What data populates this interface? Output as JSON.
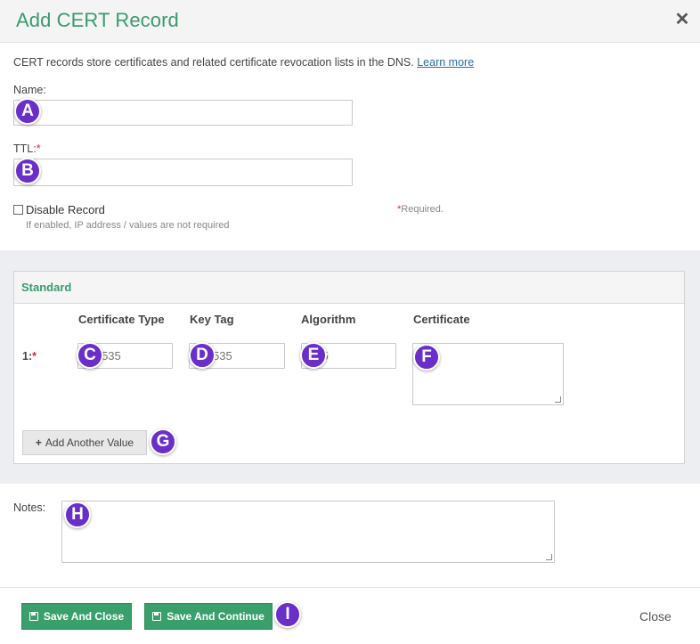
{
  "dialog": {
    "title": "Add CERT Record",
    "close_icon": "close-icon"
  },
  "intro": {
    "text": "CERT records store certificates and related certificate revocation lists in the DNS.",
    "learn_more": "Learn more"
  },
  "fields": {
    "name_label": "Name:",
    "name_value": "",
    "ttl_label": "TTL:",
    "ttl_required": "*",
    "ttl_value": ""
  },
  "disable_record": {
    "label": "Disable Record",
    "hint": "If enabled, IP address / values are not required",
    "checked": false
  },
  "required_note": {
    "star": "*",
    "text": "Required."
  },
  "standard": {
    "title": "Standard",
    "columns": [
      "Certificate Type",
      "Key Tag",
      "Algorithm",
      "Certificate"
    ],
    "row_label": "1:",
    "row_required": "*",
    "placeholders": {
      "cert_type": "65,535",
      "key_tag": "65,535",
      "algorithm": "255"
    },
    "add_button": "Add Another Value"
  },
  "notes": {
    "label": "Notes:"
  },
  "footer": {
    "save_close": "Save And Close",
    "save_continue": "Save And Continue",
    "close": "Close"
  },
  "markers": [
    "A",
    "B",
    "C",
    "D",
    "E",
    "F",
    "G",
    "H",
    "I"
  ],
  "colors": {
    "accent_green": "#3a9a6e",
    "button_green": "#3aa06b",
    "marker_purple": "#6a2fc8",
    "required_red": "#d9263a",
    "link_blue": "#2a6ea0"
  }
}
